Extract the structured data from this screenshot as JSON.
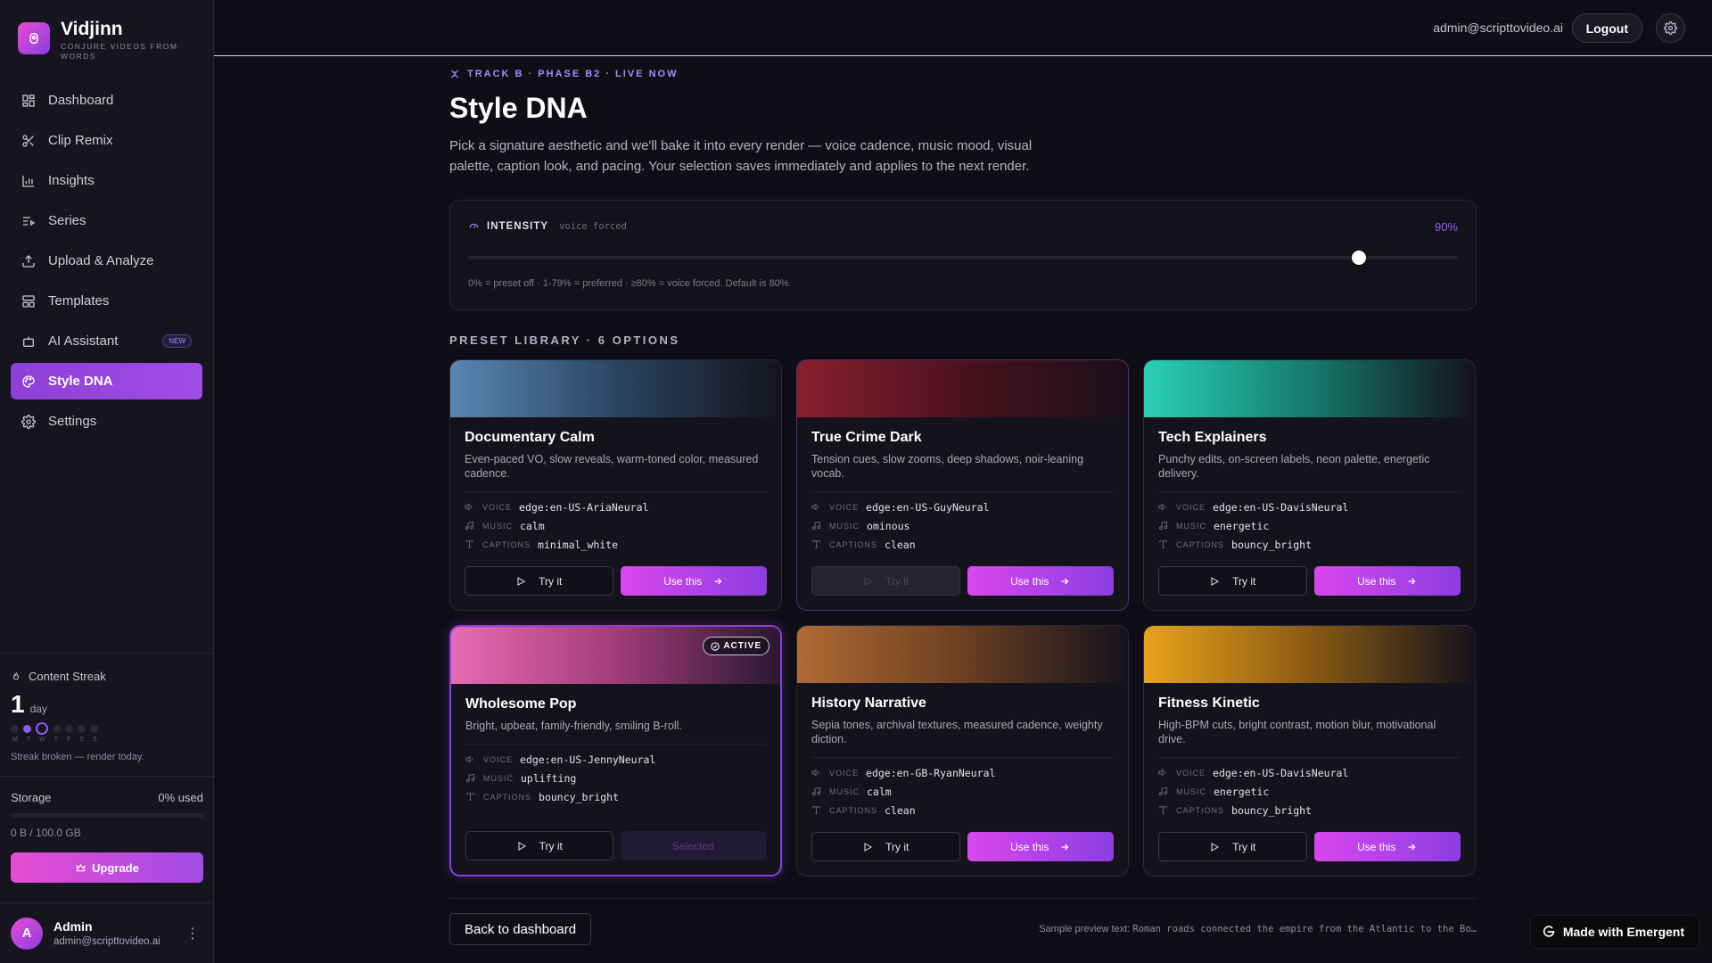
{
  "brand": {
    "name": "Vidjinn",
    "tagline": "CONJURE VIDEOS FROM WORDS"
  },
  "nav": [
    {
      "label": "Dashboard",
      "icon": "grid-icon"
    },
    {
      "label": "Clip Remix",
      "icon": "scissors-icon"
    },
    {
      "label": "Insights",
      "icon": "bar-chart-icon"
    },
    {
      "label": "Series",
      "icon": "list-play-icon"
    },
    {
      "label": "Upload & Analyze",
      "icon": "upload-icon"
    },
    {
      "label": "Templates",
      "icon": "layout-icon"
    },
    {
      "label": "AI Assistant",
      "icon": "bot-icon",
      "badge": "NEW"
    },
    {
      "label": "Style DNA",
      "icon": "palette-icon",
      "active": true
    },
    {
      "label": "Settings",
      "icon": "gear-icon"
    }
  ],
  "streak": {
    "title": "Content Streak",
    "count": "1",
    "unit": "day",
    "days": [
      "M",
      "T",
      "W",
      "T",
      "F",
      "S",
      "S"
    ],
    "message": "Streak broken — render today."
  },
  "storage": {
    "label": "Storage",
    "used": "0% used",
    "used_fraction": 0,
    "detail": "0 B / 100.0 GB",
    "upgrade_label": "Upgrade"
  },
  "user": {
    "initial": "A",
    "name": "Admin",
    "email": "admin@scripttovideo.ai"
  },
  "topbar": {
    "email": "admin@scripttovideo.ai",
    "logout_label": "Logout"
  },
  "page": {
    "eyebrow": "TRACK B · PHASE B2 · LIVE NOW",
    "title": "Style DNA",
    "description": "Pick a signature aesthetic and we'll bake it into every render — voice cadence, music mood, visual palette, caption look, and pacing. Your selection saves immediately and applies to the next render."
  },
  "intensity": {
    "label": "INTENSITY",
    "sub": "voice forced",
    "value_text": "90%",
    "value": 0.9,
    "help": "0% = preset off · 1-79% = preferred · ≥80% = voice forced. Default is 80%."
  },
  "library": {
    "title": "PRESET LIBRARY · 6 OPTIONS"
  },
  "meta_labels": {
    "voice": "VOICE",
    "music": "MUSIC",
    "captions": "CAPTIONS"
  },
  "buttons": {
    "try": "Try it",
    "use": "Use this",
    "selected": "Selected"
  },
  "active_badge": "ACTIVE",
  "presets": [
    {
      "title": "Documentary Calm",
      "description": "Even-paced VO, slow reveals, warm-toned color, measured cadence.",
      "voice": "edge:en-US-AriaNeural",
      "music": "calm",
      "captions": "minimal_white",
      "colors": [
        "#5a86b3",
        "#2a4561",
        "#14131c"
      ]
    },
    {
      "title": "True Crime Dark",
      "description": "Tension cues, slow zooms, deep shadows, noir-leaning vocab.",
      "voice": "edge:en-US-GuyNeural",
      "music": "ominous",
      "captions": "clean",
      "colors": [
        "#8a1f2e",
        "#4a1220",
        "#1a0f18"
      ]
    },
    {
      "title": "Tech Explainers",
      "description": "Punchy edits, on-screen labels, neon palette, energetic delivery.",
      "voice": "edge:en-US-DavisNeural",
      "music": "energetic",
      "captions": "bouncy_bright",
      "colors": [
        "#2bd1b4",
        "#167a6c",
        "#14131c"
      ]
    },
    {
      "title": "Wholesome Pop",
      "description": "Bright, upbeat, family-friendly, smiling B-roll.",
      "voice": "edge:en-US-JennyNeural",
      "music": "uplifting",
      "captions": "bouncy_bright",
      "colors": [
        "#e86cb4",
        "#a23c78",
        "#2a1830"
      ],
      "active": true
    },
    {
      "title": "History Narrative",
      "description": "Sepia tones, archival textures, measured cadence, weighty diction.",
      "voice": "edge:en-GB-RyanNeural",
      "music": "calm",
      "captions": "clean",
      "colors": [
        "#b06a35",
        "#6b3f22",
        "#14131c"
      ]
    },
    {
      "title": "Fitness Kinetic",
      "description": "High-BPM cuts, bright contrast, motion blur, motivational drive.",
      "voice": "edge:en-US-DavisNeural",
      "music": "energetic",
      "captions": "bouncy_bright",
      "colors": [
        "#e8a21a",
        "#8a5a14",
        "#14131c"
      ]
    }
  ],
  "footer": {
    "back_label": "Back to dashboard",
    "sample_label": "Sample preview text:",
    "sample_text": "Roman roads connected the empire from the Atlantic to the Bo…"
  },
  "badge": {
    "label": "Made with Emergent"
  }
}
